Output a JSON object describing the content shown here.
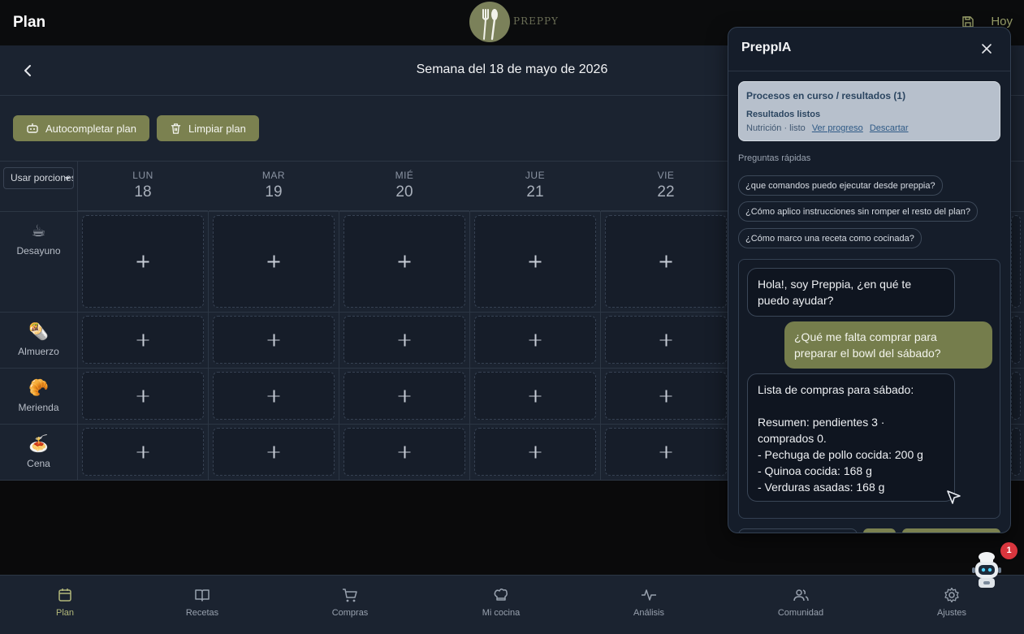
{
  "header": {
    "title": "Plan",
    "logo_text": "PREPPY",
    "today_label": "Hoy"
  },
  "week": {
    "title": "Semana del 18 de mayo de 2026"
  },
  "toolbar": {
    "autofill_label": "Autocompletar plan",
    "clear_label": "Limpiar plan"
  },
  "portion_select": {
    "value": "Usar porciones"
  },
  "days": [
    {
      "name": "LUN",
      "num": "18"
    },
    {
      "name": "MAR",
      "num": "19"
    },
    {
      "name": "MIÉ",
      "num": "20"
    },
    {
      "name": "JUE",
      "num": "21"
    },
    {
      "name": "VIE",
      "num": "22"
    }
  ],
  "meals": [
    {
      "label": "Desayuno",
      "emoji": "☕"
    },
    {
      "label": "Almuerzo",
      "emoji": "🌯"
    },
    {
      "label": "Merienda",
      "emoji": "🥐"
    },
    {
      "label": "Cena",
      "emoji": "🍝"
    }
  ],
  "nav": [
    {
      "label": "Plan",
      "icon": "calendar-icon",
      "active": true
    },
    {
      "label": "Recetas",
      "icon": "book-icon"
    },
    {
      "label": "Compras",
      "icon": "cart-icon"
    },
    {
      "label": "Mi cocina",
      "icon": "chef-hat-icon"
    },
    {
      "label": "Análisis",
      "icon": "activity-icon"
    },
    {
      "label": "Comunidad",
      "icon": "users-icon"
    },
    {
      "label": "Ajustes",
      "icon": "gear-icon"
    }
  ],
  "chat": {
    "title": "PreppIA",
    "process": {
      "title": "Procesos en curso / resultados (1)",
      "status": "Resultados listos",
      "meta": "Nutrición · listo",
      "view_link": "Ver progreso",
      "dismiss_link": "Descartar"
    },
    "quick_label": "Preguntas rápidas",
    "quick_questions": [
      "¿que comandos puedo ejecutar desde preppia?",
      "¿Cómo aplico instrucciones sin romper el resto del plan?",
      "¿Cómo marco una receta como cocinada?"
    ],
    "messages": [
      {
        "from": "bot",
        "lines": [
          "Hola!, soy Preppia, ¿en qué te",
          "puedo ayudar?"
        ]
      },
      {
        "from": "user",
        "lines": [
          "¿Qué me falta comprar para",
          "preparar el bowl del sábado?"
        ]
      },
      {
        "from": "bot",
        "lines": [
          "Lista de compras para sábado:",
          "",
          "Resumen: pendientes 3 ·",
          "comprados 0.",
          "- Pechuga de pollo cocida: 200 g",
          "- Quinoa cocida: 168 g",
          "- Verduras asadas: 168 g"
        ]
      }
    ]
  },
  "assistant_fab": {
    "badge": "1",
    "icon": "robot-chef-icon"
  },
  "colors": {
    "olive": "#7b8150",
    "panel": "#1b2330",
    "accent_text": "#b2b87a",
    "badge": "#d9363e"
  }
}
